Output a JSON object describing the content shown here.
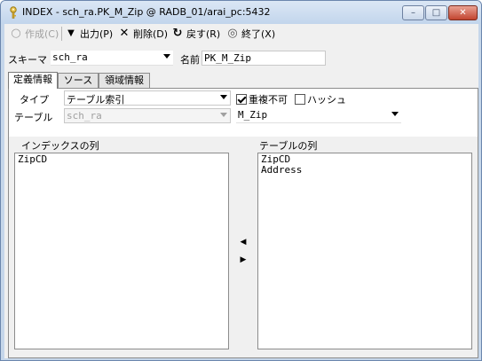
{
  "window": {
    "title": "INDEX - sch_ra.PK_M_Zip @ RADB_01/arai_pc:5432",
    "minimize_glyph": "–",
    "maximize_glyph": "□",
    "close_glyph": "✕"
  },
  "toolbar": {
    "create_label": "作成(C)",
    "output_label": "出力(P)",
    "delete_label": "削除(D)",
    "back_label": "戻す(R)",
    "exit_label": "終了(X)",
    "icons": {
      "create": "○",
      "output": "▼",
      "delete": "✕",
      "back": "↻",
      "exit": "◎"
    }
  },
  "header": {
    "schema_label": "スキーマ",
    "schema_value": "sch_ra",
    "name_label": "名前",
    "name_value": "PK_M_Zip"
  },
  "tabs": [
    {
      "label": "定義情報",
      "active": true
    },
    {
      "label": "ソース",
      "active": false
    },
    {
      "label": "領域情報",
      "active": false
    }
  ],
  "definition": {
    "type_label": "タイプ",
    "type_value": "テーブル索引",
    "unique_label": "重複不可",
    "unique_checked": true,
    "hash_label": "ハッシュ",
    "hash_checked": false,
    "table_label": "テーブル",
    "table_schema_value": "sch_ra",
    "table_name_value": "M_Zip",
    "index_columns_label": "インデックスの列",
    "index_columns": [
      "ZipCD"
    ],
    "table_columns_label": "テーブルの列",
    "table_columns": [
      "ZipCD",
      "Address"
    ],
    "move_left_glyph": "◀",
    "move_right_glyph": "▶"
  }
}
